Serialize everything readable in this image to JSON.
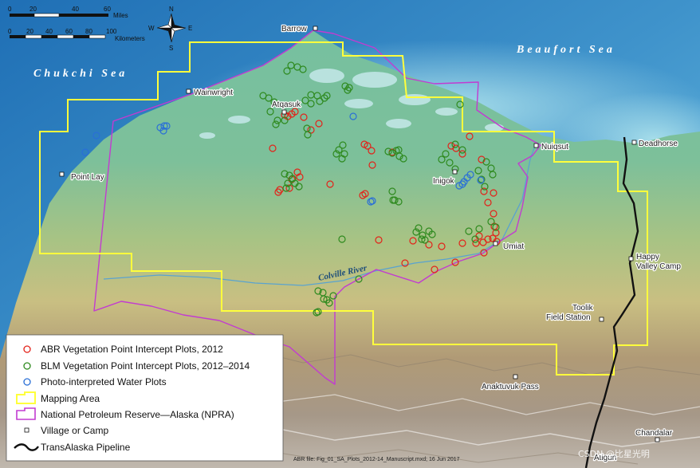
{
  "map": {
    "seas": [
      "Chukchi Sea",
      "Beaufort Sea"
    ],
    "river": "Colville River",
    "places": {
      "barrow": "Barrow",
      "wainwright": "Wainwright",
      "atqasuk": "Atqasuk",
      "nuiqsut": "Nuiqsut",
      "deadhorse": "Deadhorse",
      "point_lay": "Point Lay",
      "inigok": "Inigok",
      "umiat": "Umiat",
      "happy_valley_1": "Happy",
      "happy_valley_2": "Valley Camp",
      "toolik_1": "Toolik",
      "toolik_2": "Field Station",
      "anaktuvuk": "Anaktuvuk Pass",
      "chandalar": "Chandalar",
      "atigun": "Atigun"
    },
    "credit": "ABR file: Fig_01_SA_Plots_2012-14_Manuscript.mxd; 16 Jun 2017",
    "watermark": "CSDN @比星光明"
  },
  "scalebar": {
    "miles_unit": "Miles",
    "km_unit": "Kilometers",
    "miles_ticks": [
      "0",
      "20",
      "40",
      "60"
    ],
    "km_ticks": [
      "0",
      "20",
      "40",
      "60",
      "80",
      "100"
    ]
  },
  "north_arrow": {
    "n": "N",
    "s": "S",
    "e": "E",
    "w": "W"
  },
  "legend": {
    "abr_plots": "ABR Vegetation Point Intercept Plots, 2012",
    "blm_plots": "BLM Vegetation Point Intercept Plots, 2012–2014",
    "water_plots": "Photo-interpreted Water Plots",
    "mapping_area": "Mapping Area",
    "npra": "National Petroleum Reserve—Alaska (NPRA)",
    "village": "Village or Camp",
    "pipeline": "TransAlaska Pipeline"
  },
  "colors": {
    "abr": "#e32219",
    "blm": "#2e8a1e",
    "water": "#2a6fd6",
    "mapping_area": "#ffff3c",
    "npra": "#c23bd1",
    "pipeline": "#111111"
  },
  "plots": {
    "abr": [
      [
        357,
        144
      ],
      [
        361,
        146
      ],
      [
        366,
        143
      ],
      [
        370,
        140
      ],
      [
        381,
        147
      ],
      [
        390,
        163
      ],
      [
        400,
        155
      ],
      [
        342,
        186
      ],
      [
        351,
        238
      ],
      [
        349,
        241
      ],
      [
        363,
        236
      ],
      [
        366,
        225
      ],
      [
        373,
        216
      ],
      [
        376,
        222
      ],
      [
        414,
        231
      ],
      [
        461,
        183
      ],
      [
        466,
        189
      ],
      [
        457,
        181
      ],
      [
        467,
        207
      ],
      [
        455,
        245
      ],
      [
        458,
        243
      ],
      [
        475,
        301
      ],
      [
        492,
        191
      ],
      [
        508,
        330
      ],
      [
        518,
        302
      ],
      [
        545,
        338
      ],
      [
        538,
        307
      ],
      [
        554,
        309
      ],
      [
        566,
        183
      ],
      [
        572,
        186
      ],
      [
        580,
        193
      ],
      [
        589,
        171
      ],
      [
        604,
        200
      ],
      [
        607,
        240
      ],
      [
        619,
        242
      ],
      [
        612,
        254
      ],
      [
        619,
        268
      ],
      [
        620,
        284
      ],
      [
        622,
        292
      ],
      [
        618,
        299
      ],
      [
        623,
        303
      ],
      [
        612,
        300
      ],
      [
        601,
        296
      ],
      [
        606,
        304
      ],
      [
        597,
        305
      ],
      [
        580,
        305
      ],
      [
        607,
        317
      ],
      [
        571,
        329
      ]
    ],
    "blm": [
      [
        365,
        82
      ],
      [
        373,
        84
      ],
      [
        380,
        87
      ],
      [
        360,
        89
      ],
      [
        390,
        119
      ],
      [
        398,
        120
      ],
      [
        407,
        123
      ],
      [
        383,
        126
      ],
      [
        401,
        127
      ],
      [
        390,
        130
      ],
      [
        410,
        120
      ],
      [
        433,
        108
      ],
      [
        438,
        110
      ],
      [
        436,
        113
      ],
      [
        330,
        120
      ],
      [
        337,
        123
      ],
      [
        344,
        128
      ],
      [
        339,
        140
      ],
      [
        348,
        151
      ],
      [
        346,
        156
      ],
      [
        357,
        151
      ],
      [
        385,
        161
      ],
      [
        386,
        169
      ],
      [
        425,
        188
      ],
      [
        430,
        182
      ],
      [
        432,
        193
      ],
      [
        429,
        199
      ],
      [
        422,
        193
      ],
      [
        487,
        190
      ],
      [
        492,
        192
      ],
      [
        497,
        189
      ],
      [
        500,
        188
      ],
      [
        501,
        196
      ],
      [
        506,
        199
      ],
      [
        429,
        300
      ],
      [
        361,
        230
      ],
      [
        357,
        218
      ],
      [
        359,
        236
      ],
      [
        367,
        224
      ],
      [
        370,
        230
      ],
      [
        375,
        234
      ],
      [
        363,
        220
      ],
      [
        492,
        240
      ],
      [
        495,
        251
      ],
      [
        500,
        253
      ],
      [
        493,
        251
      ],
      [
        525,
        286
      ],
      [
        530,
        295
      ],
      [
        522,
        291
      ],
      [
        538,
        290
      ],
      [
        542,
        294
      ],
      [
        533,
        301
      ],
      [
        529,
        300
      ],
      [
        554,
        200
      ],
      [
        559,
        193
      ],
      [
        564,
        204
      ],
      [
        571,
        212
      ],
      [
        571,
        181
      ],
      [
        580,
        188
      ],
      [
        600,
        214
      ],
      [
        610,
        203
      ],
      [
        616,
        211
      ],
      [
        618,
        219
      ],
      [
        604,
        225
      ],
      [
        608,
        234
      ],
      [
        616,
        278
      ],
      [
        622,
        285
      ],
      [
        596,
        300
      ],
      [
        588,
        290
      ],
      [
        601,
        287
      ],
      [
        405,
        367
      ],
      [
        410,
        376
      ],
      [
        418,
        371
      ],
      [
        399,
        365
      ],
      [
        406,
        375
      ],
      [
        413,
        380
      ],
      [
        397,
        392
      ],
      [
        399,
        391
      ],
      [
        577,
        131
      ],
      [
        450,
        350
      ]
    ],
    "water": [
      [
        121,
        170
      ],
      [
        206,
        158
      ],
      [
        209,
        158
      ],
      [
        201,
        160
      ],
      [
        205,
        164
      ],
      [
        107,
        191
      ],
      [
        443,
        146
      ],
      [
        465,
        253
      ],
      [
        467,
        252
      ],
      [
        576,
        233
      ],
      [
        582,
        228
      ],
      [
        586,
        223
      ],
      [
        590,
        219
      ],
      [
        580,
        231
      ],
      [
        603,
        226
      ]
    ]
  }
}
